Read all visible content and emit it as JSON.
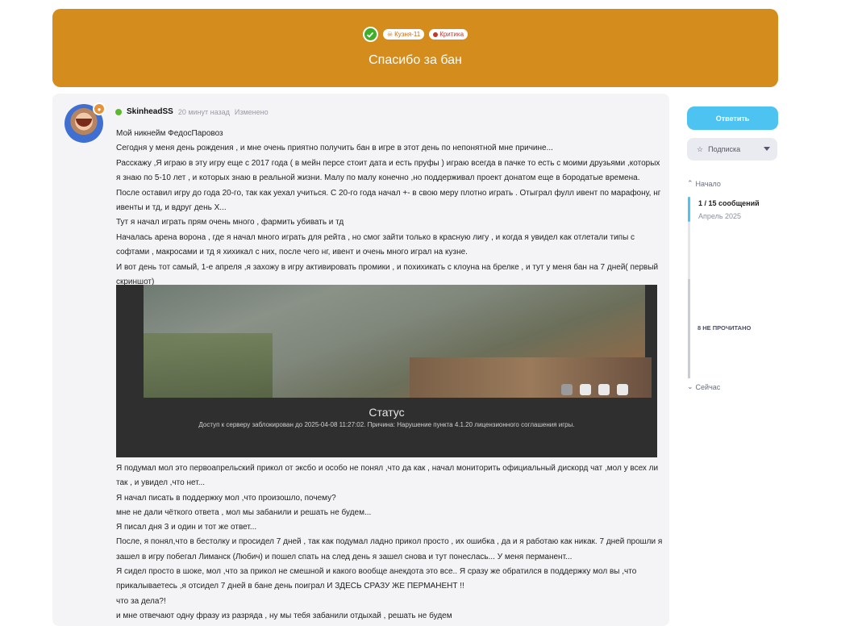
{
  "topic": {
    "title": "Спасибо за бан",
    "tags": [
      {
        "label": "Кузня-11"
      },
      {
        "label": "Критика"
      }
    ],
    "colors": {
      "header_bg": "#d48c1c",
      "tag_forge": "#c86b10",
      "tag_crit": "#c0392b"
    }
  },
  "post": {
    "author": "SkinheadSS",
    "time": "20 минут назад",
    "edited": "Изменено",
    "paragraphs_top": [
      "Мой никнейм ФедосПаровоз",
      "Сегодня у меня день рождения , и мне очень приятно получить бан в игре в этот день по непонятной мне причине...",
      "Расскажу ,Я играю в эту игру еще с 2017 года ( в мейн персе стоит дата и есть пруфы ) играю всегда в пачке то есть с моими друзьями ,которых я знаю по 5-10 лет , и которых знаю в реальной жизни. Малу по малу конечно ,но поддерживал проект донатом еще в бородатые времена. После оставил игру до года 20-го, так как уехал учиться. С 20-го года начал +- в свою меру плотно играть . Отыграл фулл ивент по марафону, нг ивенты и тд, и вдруг день Х...",
      "Тут я начал играть прям очень много , фармить убивать и тд",
      "Началась арена ворона , где я начал много играть для рейта , но смог зайти только в красную лигу , и когда я увидел как отлетали типы с софтами , макросами и тд я хихикал с них, после чего нг, ивент и очень много играл на кузне.",
      "И вот день тот самый, 1-е апреля ,я захожу в игру активировать промики , и похихикать с клоуна на брелке , и тут у меня бан на 7 дней( первый скриншот)"
    ],
    "screenshot": {
      "status_title": "Статус",
      "status_text": "Доступ к серверу заблокирован до 2025-04-08 11:27:02. Причина: Нарушение пункта 4.1.20 лицензионного соглашения игры."
    },
    "paragraphs_bottom": [
      "Я подумал мол это первоапрельский прикол от эксбо и особо не понял ,что да как , начал мониторить официальный дискорд чат ,мол у всех ли так , и увидел ,что нет...",
      "Я начал писать в поддержку мол ,что произошло, почему?",
      "мне не дали чёткого ответа , мол мы забанили и решать не будем...",
      "Я писал дня 3 и один и тот же ответ...",
      "После, я понял,что в бестолку и просидел 7 дней , так как подумал ладно прикол просто , их ошибка , да и я работаю как никак. 7 дней прошли я зашел в игру побегал Лиманск (Любич) и пошел спать на след день я зашел снова и тут понеслась... У меня перманент...",
      "Я сидел просто в шоке, мол ,что за прикол не смешной и какого вообще анекдота это все.. Я сразу же обратился в поддержку мол вы ,что прикалываетесь ,я отсидел 7 дней в бане день поиграл И ЗДЕСЬ СРАЗУ ЖЕ ПЕРМАНЕНТ !!",
      "что за дела?!",
      "и мне отвечают одну фразу из разряда , ну мы тебя забанили отдыхай , решать не будем"
    ]
  },
  "sidebar": {
    "reply_label": "Ответить",
    "subscribe_label": "Подписка",
    "start_label": "Начало",
    "now_label": "Сейчас",
    "timeline": {
      "count": "1 / 15 сообщений",
      "date": "Апрель 2025",
      "unread": "8 НЕ ПРОЧИТАНО"
    },
    "accent": "#4cc3f0"
  }
}
